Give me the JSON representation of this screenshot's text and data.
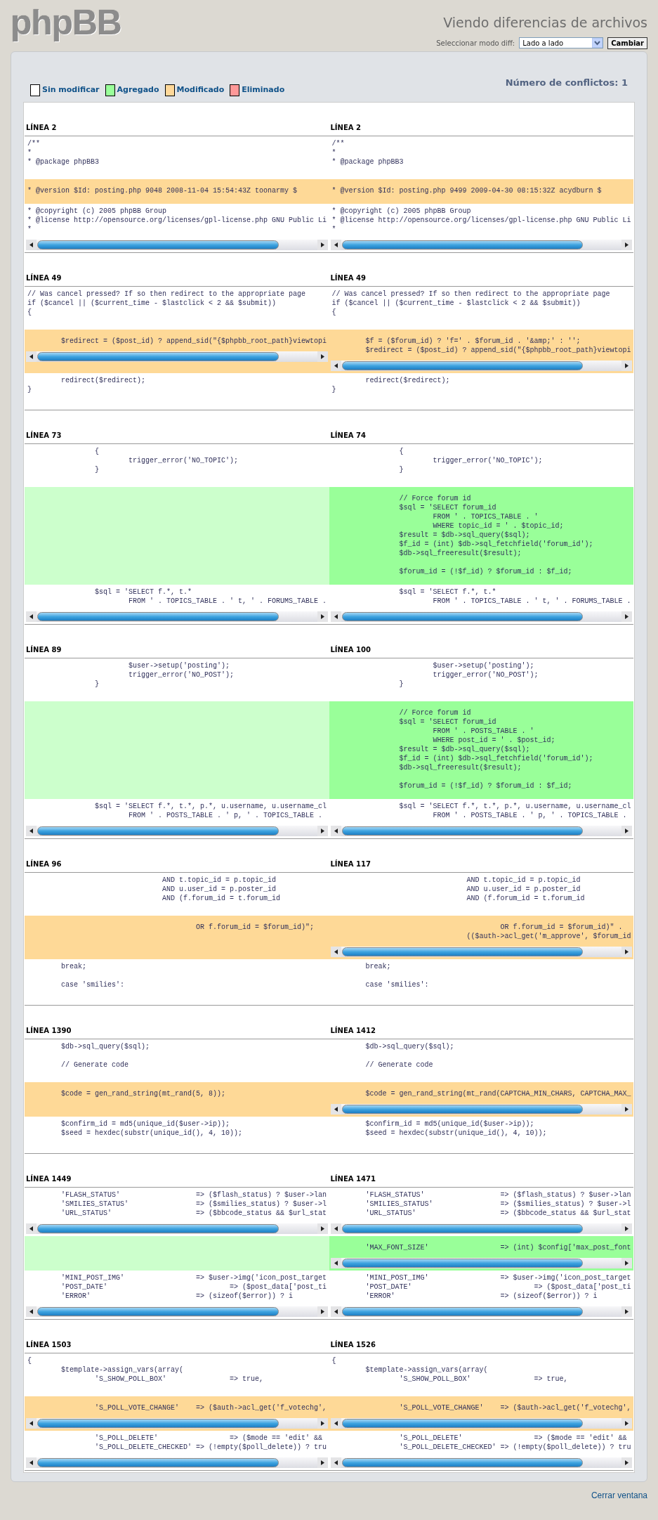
{
  "header": {
    "logo": "phpBB",
    "title": "Viendo diferencias de archivos",
    "mode_label": "Seleccionar modo diff:",
    "mode_select": {
      "value": "Lado a lado"
    },
    "change_button": "Cambiar"
  },
  "legend": [
    {
      "label": "Sin modificar",
      "color": "#ffffff"
    },
    {
      "label": "Agregado",
      "color": "#99ff99"
    },
    {
      "label": "Modificado",
      "color": "#ffd899"
    },
    {
      "label": "Eliminado",
      "color": "#ff9999"
    }
  ],
  "conflicts": "Número de conflictos: 1",
  "blocks": [
    {
      "left_header": "LÍNEA 2",
      "right_header": "LÍNEA 2",
      "segments": [
        {
          "kind": "context",
          "left": {
            "code": "/**\n*\n* @package phpBB3",
            "scrollbar": false
          },
          "right": {
            "code": "/**\n*\n* @package phpBB3",
            "scrollbar": false
          }
        },
        {
          "kind": "modified",
          "left": {
            "code": "* @version $Id: posting.php 9048 2008-11-04 15:54:43Z toonarmy $",
            "scrollbar": false
          },
          "right": {
            "code": "* @version $Id: posting.php 9499 2009-04-30 08:15:32Z acydburn $",
            "scrollbar": false
          }
        },
        {
          "kind": "context",
          "left": {
            "code": "* @copyright (c) 2005 phpBB Group\n* @license http://opensource.org/licenses/gpl-license.php GNU Public Li\n*",
            "scrollbar": true
          },
          "right": {
            "code": "* @copyright (c) 2005 phpBB Group\n* @license http://opensource.org/licenses/gpl-license.php GNU Public Li\n*",
            "scrollbar": true
          }
        }
      ]
    },
    {
      "left_header": "LÍNEA 49",
      "right_header": "LÍNEA 49",
      "segments": [
        {
          "kind": "context",
          "left": {
            "code": "// Was cancel pressed? If so then redirect to the appropriate page\nif ($cancel || ($current_time - $lastclick < 2 && $submit))\n{",
            "scrollbar": false
          },
          "right": {
            "code": "// Was cancel pressed? If so then redirect to the appropriate page\nif ($cancel || ($current_time - $lastclick < 2 && $submit))\n{",
            "scrollbar": false
          }
        },
        {
          "kind": "modified",
          "left": {
            "code": "\t$redirect = ($post_id) ? append_sid(\"{$phpbb_root_path}viewtopi",
            "scrollbar": true
          },
          "right": {
            "code": "\t$f = ($forum_id) ? 'f=' . $forum_id . '&amp;' : '';\n\t$redirect = ($post_id) ? append_sid(\"{$phpbb_root_path}viewtopi",
            "scrollbar": true
          }
        },
        {
          "kind": "context",
          "left": {
            "code": "\tredirect($redirect);\n}",
            "scrollbar": false
          },
          "right": {
            "code": "\tredirect($redirect);\n}",
            "scrollbar": false
          }
        }
      ]
    },
    {
      "left_header": "LÍNEA 73",
      "right_header": "LÍNEA 74",
      "segments": [
        {
          "kind": "context",
          "left": {
            "code": "\t\t{\n\t\t\ttrigger_error('NO_TOPIC');\n\t\t}",
            "scrollbar": false
          },
          "right": {
            "code": "\t\t{\n\t\t\ttrigger_error('NO_TOPIC');\n\t\t}",
            "scrollbar": false
          }
        },
        {
          "kind": "added",
          "left": {
            "scrollbar": false
          },
          "right": {
            "code": "\t\t// Force forum id\n\t\t$sql = 'SELECT forum_id\n\t\t\tFROM ' . TOPICS_TABLE . '\n\t\t\tWHERE topic_id = ' . $topic_id;\n\t\t$result = $db->sql_query($sql);\n\t\t$f_id = (int) $db->sql_fetchfield('forum_id');\n\t\t$db->sql_freeresult($result);\n\n\t\t$forum_id = (!$f_id) ? $forum_id : $f_id;",
            "scrollbar": false
          }
        },
        {
          "kind": "context",
          "left": {
            "code": "\t\t$sql = 'SELECT f.*, t.*\n\t\t\tFROM ' . TOPICS_TABLE . ' t, ' . FORUMS_TABLE .",
            "scrollbar": true
          },
          "right": {
            "code": "\t\t$sql = 'SELECT f.*, t.*\n\t\t\tFROM ' . TOPICS_TABLE . ' t, ' . FORUMS_TABLE .",
            "scrollbar": true
          }
        }
      ]
    },
    {
      "left_header": "LÍNEA 89",
      "right_header": "LÍNEA 100",
      "segments": [
        {
          "kind": "context",
          "left": {
            "code": "\t\t\t$user->setup('posting');\n\t\t\ttrigger_error('NO_POST');\n\t\t}",
            "scrollbar": false
          },
          "right": {
            "code": "\t\t\t$user->setup('posting');\n\t\t\ttrigger_error('NO_POST');\n\t\t}",
            "scrollbar": false
          }
        },
        {
          "kind": "added",
          "left": {
            "scrollbar": false
          },
          "right": {
            "code": "\t\t// Force forum id\n\t\t$sql = 'SELECT forum_id\n\t\t\tFROM ' . POSTS_TABLE . '\n\t\t\tWHERE post_id = ' . $post_id;\n\t\t$result = $db->sql_query($sql);\n\t\t$f_id = (int) $db->sql_fetchfield('forum_id');\n\t\t$db->sql_freeresult($result);\n\n\t\t$forum_id = (!$f_id) ? $forum_id : $f_id;",
            "scrollbar": false
          }
        },
        {
          "kind": "context",
          "left": {
            "code": "\t\t$sql = 'SELECT f.*, t.*, p.*, u.username, u.username_cl\n\t\t\tFROM ' . POSTS_TABLE . ' p, ' . TOPICS_TABLE .",
            "scrollbar": true
          },
          "right": {
            "code": "\t\t$sql = 'SELECT f.*, t.*, p.*, u.username, u.username_cl\n\t\t\tFROM ' . POSTS_TABLE . ' p, ' . TOPICS_TABLE .",
            "scrollbar": true
          }
        }
      ]
    },
    {
      "left_header": "LÍNEA 96",
      "right_header": "LÍNEA 117",
      "segments": [
        {
          "kind": "context",
          "left": {
            "code": "\t\t\t\tAND t.topic_id = p.topic_id\n\t\t\t\tAND u.user_id = p.poster_id\n\t\t\t\tAND (f.forum_id = t.forum_id",
            "scrollbar": false
          },
          "right": {
            "code": "\t\t\t\tAND t.topic_id = p.topic_id\n\t\t\t\tAND u.user_id = p.poster_id\n\t\t\t\tAND (f.forum_id = t.forum_id",
            "scrollbar": false
          }
        },
        {
          "kind": "modified",
          "left": {
            "code": "\t\t\t\t\tOR f.forum_id = $forum_id)\";",
            "scrollbar": false
          },
          "right": {
            "code": "\t\t\t\t\tOR f.forum_id = $forum_id)\" .\n\t\t\t\t(($auth->acl_get('m_approve', $forum_id",
            "scrollbar": true
          }
        },
        {
          "kind": "context",
          "left": {
            "code": "\tbreak;\n\n\tcase 'smilies':",
            "scrollbar": false
          },
          "right": {
            "code": "\tbreak;\n\n\tcase 'smilies':",
            "scrollbar": false
          }
        }
      ]
    },
    {
      "left_header": "LÍNEA 1390",
      "right_header": "LÍNEA 1412",
      "segments": [
        {
          "kind": "context",
          "left": {
            "code": "\t$db->sql_query($sql);\n\n\t// Generate code",
            "scrollbar": false
          },
          "right": {
            "code": "\t$db->sql_query($sql);\n\n\t// Generate code",
            "scrollbar": false
          }
        },
        {
          "kind": "modified",
          "left": {
            "code": "\t$code = gen_rand_string(mt_rand(5, 8));",
            "scrollbar": false
          },
          "right": {
            "code": "\t$code = gen_rand_string(mt_rand(CAPTCHA_MIN_CHARS, CAPTCHA_MAX_",
            "scrollbar": true
          }
        },
        {
          "kind": "context",
          "left": {
            "code": "\t$confirm_id = md5(unique_id($user->ip));\n\t$seed = hexdec(substr(unique_id(), 4, 10));",
            "scrollbar": false
          },
          "right": {
            "code": "\t$confirm_id = md5(unique_id($user->ip));\n\t$seed = hexdec(substr(unique_id(), 4, 10));",
            "scrollbar": false
          }
        }
      ]
    },
    {
      "left_header": "LÍNEA 1449",
      "right_header": "LÍNEA 1471",
      "segments": [
        {
          "kind": "context",
          "left": {
            "code": "\t'FLASH_STATUS'\t\t\t=> ($flash_status) ? $user->lan\n\t'SMILIES_STATUS'\t\t=> ($smilies_status) ? $user->l\n\t'URL_STATUS'\t\t\t=> ($bbcode_status && $url_stat",
            "scrollbar": true
          },
          "right": {
            "code": "\t'FLASH_STATUS'\t\t\t=> ($flash_status) ? $user->lan\n\t'SMILIES_STATUS'\t\t=> ($smilies_status) ? $user->l\n\t'URL_STATUS'\t\t\t=> ($bbcode_status && $url_stat",
            "scrollbar": true
          }
        },
        {
          "kind": "added",
          "left": {
            "scrollbar": false
          },
          "right": {
            "code": "\t'MAX_FONT_SIZE'\t\t\t=> (int) $config['max_post_font",
            "scrollbar": true
          }
        },
        {
          "kind": "context",
          "left": {
            "code": "\t'MINI_POST_IMG'\t\t\t=> $user->img('icon_post_target\n\t'POST_DATE'\t\t\t\t=> ($post_data['post_ti\n\t'ERROR'\t\t\t\t=> (sizeof($error)) ? i",
            "scrollbar": true
          },
          "right": {
            "code": "\t'MINI_POST_IMG'\t\t\t=> $user->img('icon_post_target\n\t'POST_DATE'\t\t\t\t=> ($post_data['post_ti\n\t'ERROR'\t\t\t\t=> (sizeof($error)) ? i",
            "scrollbar": true
          }
        }
      ]
    },
    {
      "left_header": "LÍNEA 1503",
      "right_header": "LÍNEA 1526",
      "segments": [
        {
          "kind": "context",
          "left": {
            "code": "{\n\t$template->assign_vars(array(\n\t\t'S_SHOW_POLL_BOX'\t\t=> true,",
            "scrollbar": false
          },
          "right": {
            "code": "{\n\t$template->assign_vars(array(\n\t\t'S_SHOW_POLL_BOX'\t\t=> true,",
            "scrollbar": false
          }
        },
        {
          "kind": "modified",
          "left": {
            "code": "\t\t'S_POLL_VOTE_CHANGE'\t=> ($auth->acl_get('f_votechg',",
            "scrollbar": true
          },
          "right": {
            "code": "\t\t'S_POLL_VOTE_CHANGE'\t=> ($auth->acl_get('f_votechg',",
            "scrollbar": true
          }
        },
        {
          "kind": "context",
          "left": {
            "code": "\t\t'S_POLL_DELETE'\t\t\t=> ($mode == 'edit' &&\n\t\t'S_POLL_DELETE_CHECKED'\t=> (!empty($poll_delete)) ? tru\n",
            "scrollbar": true
          },
          "right": {
            "code": "\t\t'S_POLL_DELETE'\t\t\t=> ($mode == 'edit' &&\n\t\t'S_POLL_DELETE_CHECKED'\t=> (!empty($poll_delete)) ? tru\n",
            "scrollbar": true
          }
        }
      ]
    }
  ],
  "close_link": "Cerrar ventana"
}
